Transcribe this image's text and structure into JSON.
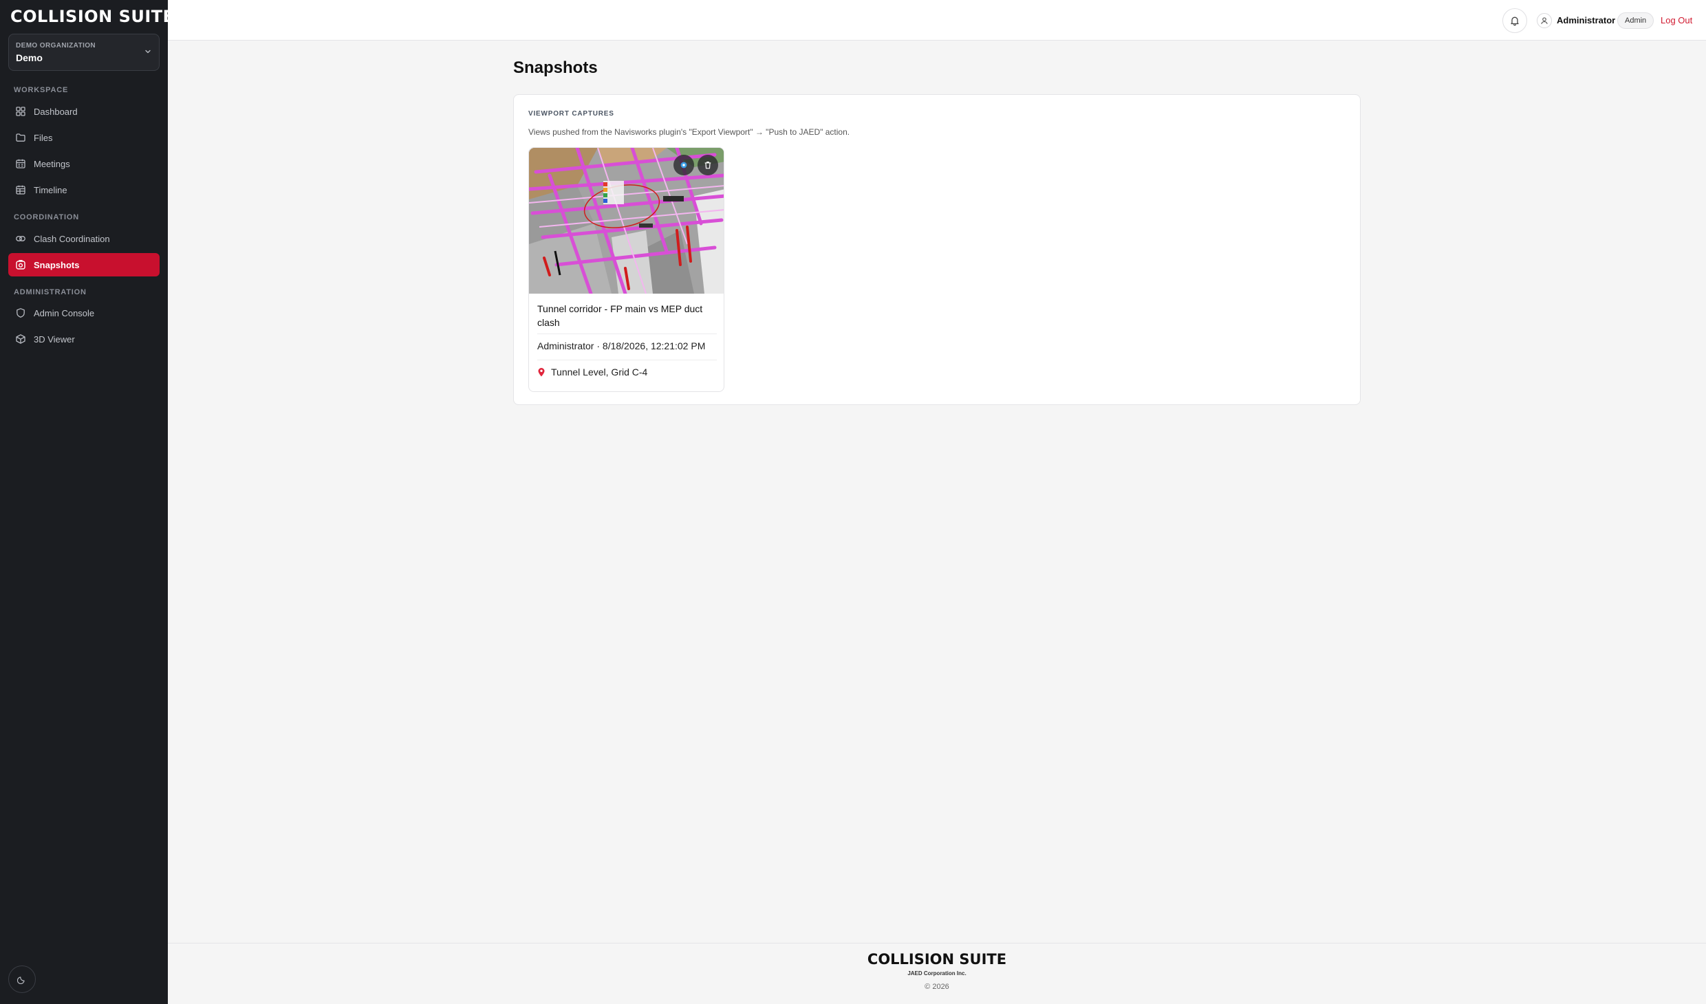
{
  "app": {
    "brand": "COLLISION SUITE",
    "org_label": "DEMO ORGANIZATION",
    "org_name": "Demo"
  },
  "sidebar": {
    "sections": [
      {
        "title": "WORKSPACE",
        "items": [
          {
            "label": "Dashboard",
            "icon": "grid-icon"
          },
          {
            "label": "Files",
            "icon": "folder-icon"
          },
          {
            "label": "Meetings",
            "icon": "calendar-icon"
          },
          {
            "label": "Timeline",
            "icon": "timeline-icon"
          }
        ]
      },
      {
        "title": "COORDINATION",
        "items": [
          {
            "label": "Clash Coordination",
            "icon": "link-icon"
          },
          {
            "label": "Snapshots",
            "icon": "camera-icon",
            "active": true
          }
        ]
      },
      {
        "title": "ADMINISTRATION",
        "items": [
          {
            "label": "Admin Console",
            "icon": "shield-icon"
          },
          {
            "label": "3D Viewer",
            "icon": "cube-icon"
          }
        ]
      }
    ],
    "theme_toggle_icon": "moon-icon"
  },
  "header": {
    "user_name": "Administrator",
    "role": "Admin",
    "logout_label": "Log Out"
  },
  "main": {
    "page_title": "Snapshots",
    "panel_title": "VIEWPORT CAPTURES",
    "panel_description": "Views pushed from the Navisworks plugin's \"Export Viewport\" → \"Push to JAED\" action.",
    "snapshots": [
      {
        "title": "Tunnel corridor - FP main vs MEP duct clash",
        "meta": "Administrator · 8/18/2026, 12:21:02 PM",
        "location": "Tunnel Level, Grid C-4"
      }
    ]
  },
  "footer": {
    "brand": "COLLISION SUITE",
    "company": "JAED Corporation Inc.",
    "copyright": "© 2026"
  },
  "colors": {
    "accent": "#c8102e",
    "sidebar_bg": "#1b1d21",
    "page_bg": "#f5f5f5",
    "logout": "#d0192f"
  }
}
